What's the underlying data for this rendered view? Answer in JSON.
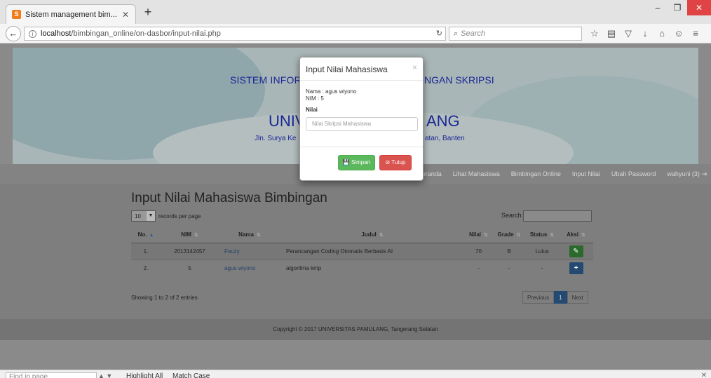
{
  "browser": {
    "tab_title": "Sistem management bim...",
    "tab_close": "✕",
    "new_tab": "+",
    "url_host": "localhost",
    "url_path": "/bimbingan_online/on-dasbor/input-nilai.php",
    "search_placeholder": "Search",
    "find_placeholder": "Find in page",
    "find_highlight": "Highlight All",
    "find_match_case": "Match Case"
  },
  "banner": {
    "title_left": "SISTEM INFOR",
    "title_right": "NGAN SKRIPSI",
    "univ_left": "UNIV",
    "univ_right": "ANG",
    "addr_left": "Jln. Surya Ke",
    "addr_right": "atan, Banten"
  },
  "nav": {
    "items": [
      "Beranda",
      "Lihat Mahasiswa",
      "Bimbingan Online",
      "Input Nilai",
      "Ubah Password",
      "wahyuni (3)"
    ]
  },
  "main": {
    "heading": "Input Nilai Mahasiswa Bimbingan",
    "records_value": "10",
    "records_label": "records per page",
    "search_label": "Search:",
    "columns": [
      "No.",
      "NIM",
      "Nama",
      "Judul",
      "Nilai",
      "Grade",
      "Status",
      "Aksi"
    ],
    "rows": [
      {
        "no": "1.",
        "nim": "2013142457",
        "nama": "Fauzy",
        "judul": "Perancangan Coding Otomatis Berbasis AI",
        "nilai": "70",
        "grade": "B",
        "status": "Lulus",
        "action": "✎"
      },
      {
        "no": "2.",
        "nim": "5",
        "nama": "agus wiyono",
        "judul": "algoritma kmp",
        "nilai": "-",
        "grade": "-",
        "status": "-",
        "action": "+"
      }
    ],
    "showing": "Showing 1 to 2 of 2 entries",
    "pager": {
      "prev": "Previous",
      "current": "1",
      "next": "Next"
    }
  },
  "footer": {
    "text": "Copyright © 2017 UNIVERSITAS PAMULANG, Tangerang Selatan"
  },
  "modal": {
    "title": "Input Nilai Mahasiswa",
    "close": "×",
    "nama_line": "Nama : agus wiyono",
    "nim_line": "NIM : 5",
    "nilai_label": "Nilai",
    "nilai_placeholder": "Nilai Skripsi Mahasiswa",
    "save_label": "Simpan",
    "close_label": "Tutup"
  }
}
